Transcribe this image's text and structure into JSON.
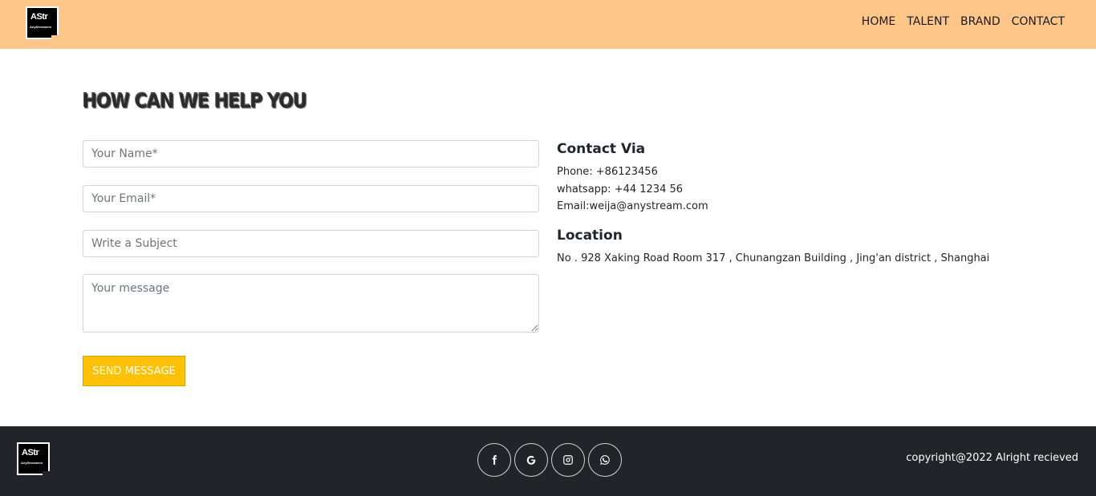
{
  "brand": {
    "logo_text": "AStr",
    "logo_subtext": "AnyStreamers"
  },
  "nav": {
    "items": [
      "HOME",
      "TALENT",
      "BRAND",
      "CONTACT"
    ]
  },
  "page": {
    "heading": "HOW CAN WE HELP YOU"
  },
  "form": {
    "name_placeholder": "Your Name*",
    "email_placeholder": "Your Email*",
    "subject_placeholder": "Write a Subject",
    "message_placeholder": "Your message",
    "send_label": "SEND MESSAGE"
  },
  "contact": {
    "title": "Contact Via",
    "phone": "Phone: +86123456",
    "whatsapp": "whatsapp: +44 1234 56",
    "email": "Email:weija@anystream.com"
  },
  "location": {
    "title": "Location",
    "address": "No . 928 Xaking Road Room 317 , Chunangzan Building , Jing'an district , Shanghai"
  },
  "footer": {
    "socials": [
      "facebook-icon",
      "google-icon",
      "instagram-icon",
      "whatsapp-icon"
    ],
    "copyright": "copyright@2022 Alright recieved"
  },
  "colors": {
    "navbar": "#ffc68a",
    "accent": "#ffc107",
    "footer": "#212529"
  }
}
